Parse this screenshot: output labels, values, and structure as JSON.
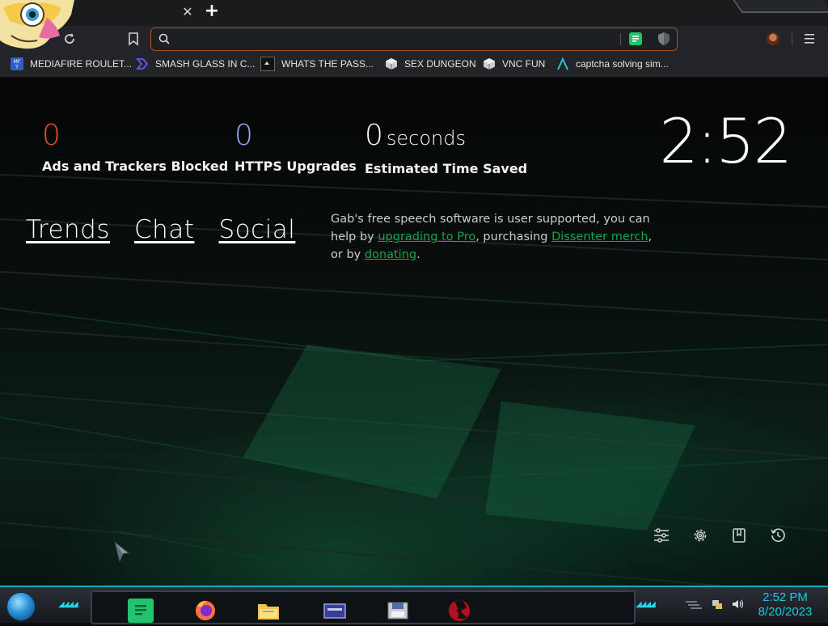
{
  "browser": {
    "omnibox": {
      "value": "",
      "placeholder": ""
    },
    "bookmarks": [
      {
        "label": "MEDIAFIRE ROULET...",
        "icon": "mediafire-icon"
      },
      {
        "label": "SMASH GLASS IN C...",
        "icon": "chevron-logo-icon"
      },
      {
        "label": "WHATS THE PASS...",
        "icon": "dark-page-icon"
      },
      {
        "label": "SEX DUNGEON",
        "icon": "cube-icon"
      },
      {
        "label": "VNC FUN",
        "icon": "cube-icon"
      },
      {
        "label": "captcha solving sim...",
        "icon": "a-logo-icon"
      }
    ]
  },
  "ntp": {
    "stats": {
      "ads_count": "0",
      "ads_label": "Ads and Trackers Blocked",
      "https_count": "0",
      "https_label": "HTTPS Upgrades",
      "time_count": "0",
      "time_unit": "seconds",
      "time_label": "Estimated Time Saved"
    },
    "clock": "2:52",
    "links": {
      "trends": "Trends",
      "chat": "Chat",
      "social": "Social"
    },
    "promo": {
      "text1": "Gab's free speech software is user supported, you can help by ",
      "link1": "upgrading to Pro",
      "text2": ", purchasing ",
      "link2": "Dissenter merch",
      "text3": ", or by ",
      "link3": "donating",
      "text4": "."
    },
    "tools": [
      "customize-icon",
      "settings-icon",
      "bookmarks-icon",
      "history-icon"
    ]
  },
  "taskbar": {
    "time": "2:52 PM",
    "date": "8/20/2023",
    "apps": [
      "gab-app",
      "firefox-app",
      "file-explorer-app",
      "window-app",
      "disk-app",
      "radiation-app"
    ]
  },
  "colors": {
    "accent_orange": "#e0502d",
    "accent_blue": "#9aa5f5",
    "gab_green": "#21c36b",
    "taskbar_cyan": "#1fc7e0"
  }
}
